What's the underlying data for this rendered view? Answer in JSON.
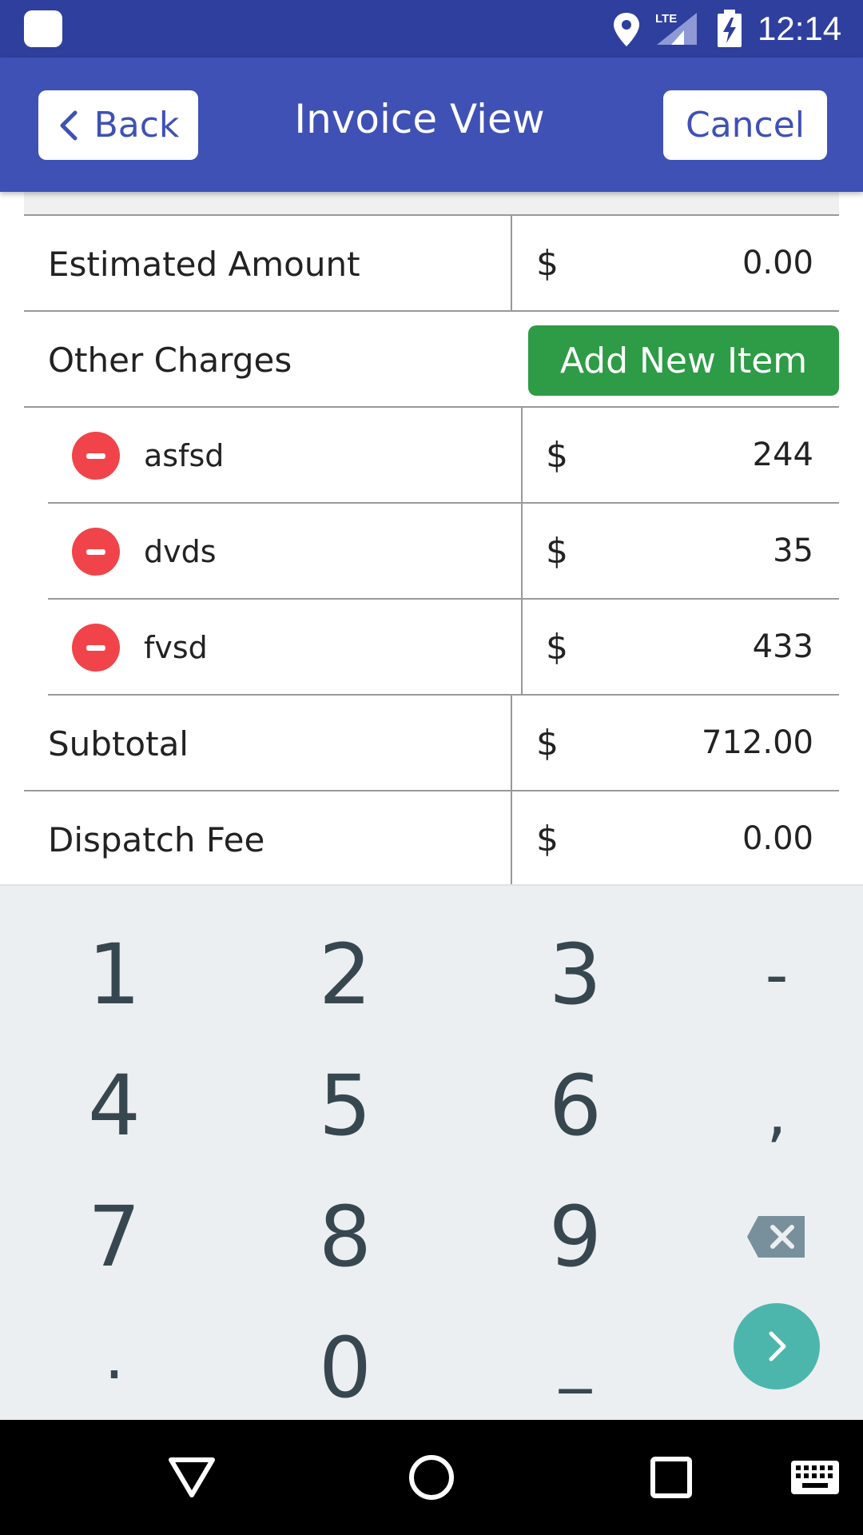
{
  "status_bar": {
    "time": "12:14",
    "network_label": "LTE",
    "icons": [
      "app-icon",
      "location-icon",
      "lte-signal-icon",
      "battery-charging-icon"
    ]
  },
  "header": {
    "back_label": "Back",
    "title": "Invoice View",
    "cancel_label": "Cancel"
  },
  "invoice": {
    "estimated": {
      "label": "Estimated Amount",
      "currency": "$",
      "amount": "0.00"
    },
    "other_charges": {
      "label": "Other Charges",
      "add_button": "Add New Item"
    },
    "items": [
      {
        "name": "asfsd",
        "currency": "$",
        "amount": "244"
      },
      {
        "name": "dvds",
        "currency": "$",
        "amount": "35"
      },
      {
        "name": "fvsd",
        "currency": "$",
        "amount": "433"
      }
    ],
    "subtotal": {
      "label": "Subtotal",
      "currency": "$",
      "amount": "712.00"
    },
    "dispatch_fee": {
      "label": "Dispatch Fee",
      "currency": "$",
      "amount": "0.00"
    }
  },
  "keyboard": {
    "keys": [
      "1",
      "2",
      "3",
      "-",
      "4",
      "5",
      "6",
      ",",
      "7",
      "8",
      "9",
      "backspace",
      ".",
      "0",
      "_",
      "next"
    ],
    "accent_color": "#4db6ac"
  },
  "colors": {
    "status_bar": "#2f3f9e",
    "app_bar": "#3f51b5",
    "add_button": "#2e9b46",
    "remove_icon": "#f0444a"
  },
  "nav_bar": {
    "icons": [
      "back-triangle-icon",
      "home-circle-icon",
      "recents-square-icon",
      "keyboard-icon"
    ]
  }
}
